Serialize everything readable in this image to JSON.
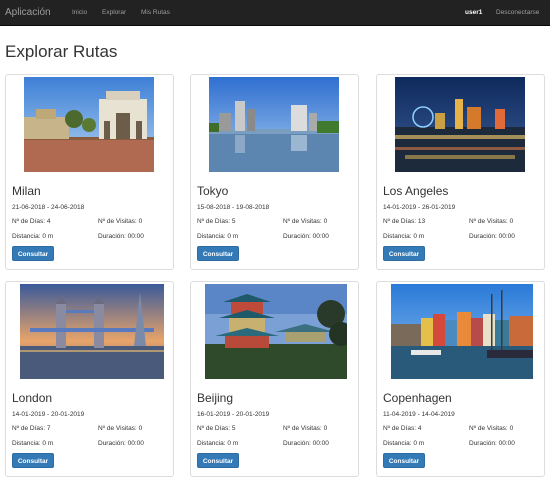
{
  "navbar": {
    "brand": "Aplicación",
    "links": [
      "Inicio",
      "Explorar",
      "Mis Rutas"
    ],
    "user": "user1",
    "logout": "Desconectarse"
  },
  "page": {
    "title": "Explorar Rutas"
  },
  "labels": {
    "days": "Nº de Días:",
    "visits": "Nº de Visitas:",
    "distance": "Distancia:",
    "duration": "Duración:",
    "button": "Consultar"
  },
  "routes": [
    {
      "city": "Milan",
      "dates": "21-06-2018 - 24-06-2018",
      "days": "4",
      "visits": "0",
      "distance": "0 m",
      "duration": "00:00",
      "image": "milan-arch-photo"
    },
    {
      "city": "Tokyo",
      "dates": "15-08-2018 - 19-08-2018",
      "days": "5",
      "visits": "0",
      "distance": "0 m",
      "duration": "00:00",
      "image": "tokyo-skyline-photo"
    },
    {
      "city": "Los Angeles",
      "dates": "14-01-2019 - 26-01-2019",
      "days": "13",
      "visits": "0",
      "distance": "0 m",
      "duration": "00:00",
      "image": "night-city-lights-photo"
    },
    {
      "city": "London",
      "dates": "14-01-2019 - 20-01-2019",
      "days": "7",
      "visits": "0",
      "distance": "0 m",
      "duration": "00:00",
      "image": "tower-bridge-photo"
    },
    {
      "city": "Beijing",
      "dates": "16-01-2019 - 20-01-2019",
      "days": "5",
      "visits": "0",
      "distance": "0 m",
      "duration": "00:00",
      "image": "pagoda-photo"
    },
    {
      "city": "Copenhagen",
      "dates": "11-04-2019 - 14-04-2019",
      "days": "4",
      "visits": "0",
      "distance": "0 m",
      "duration": "00:00",
      "image": "nyhavn-harbour-photo"
    }
  ]
}
